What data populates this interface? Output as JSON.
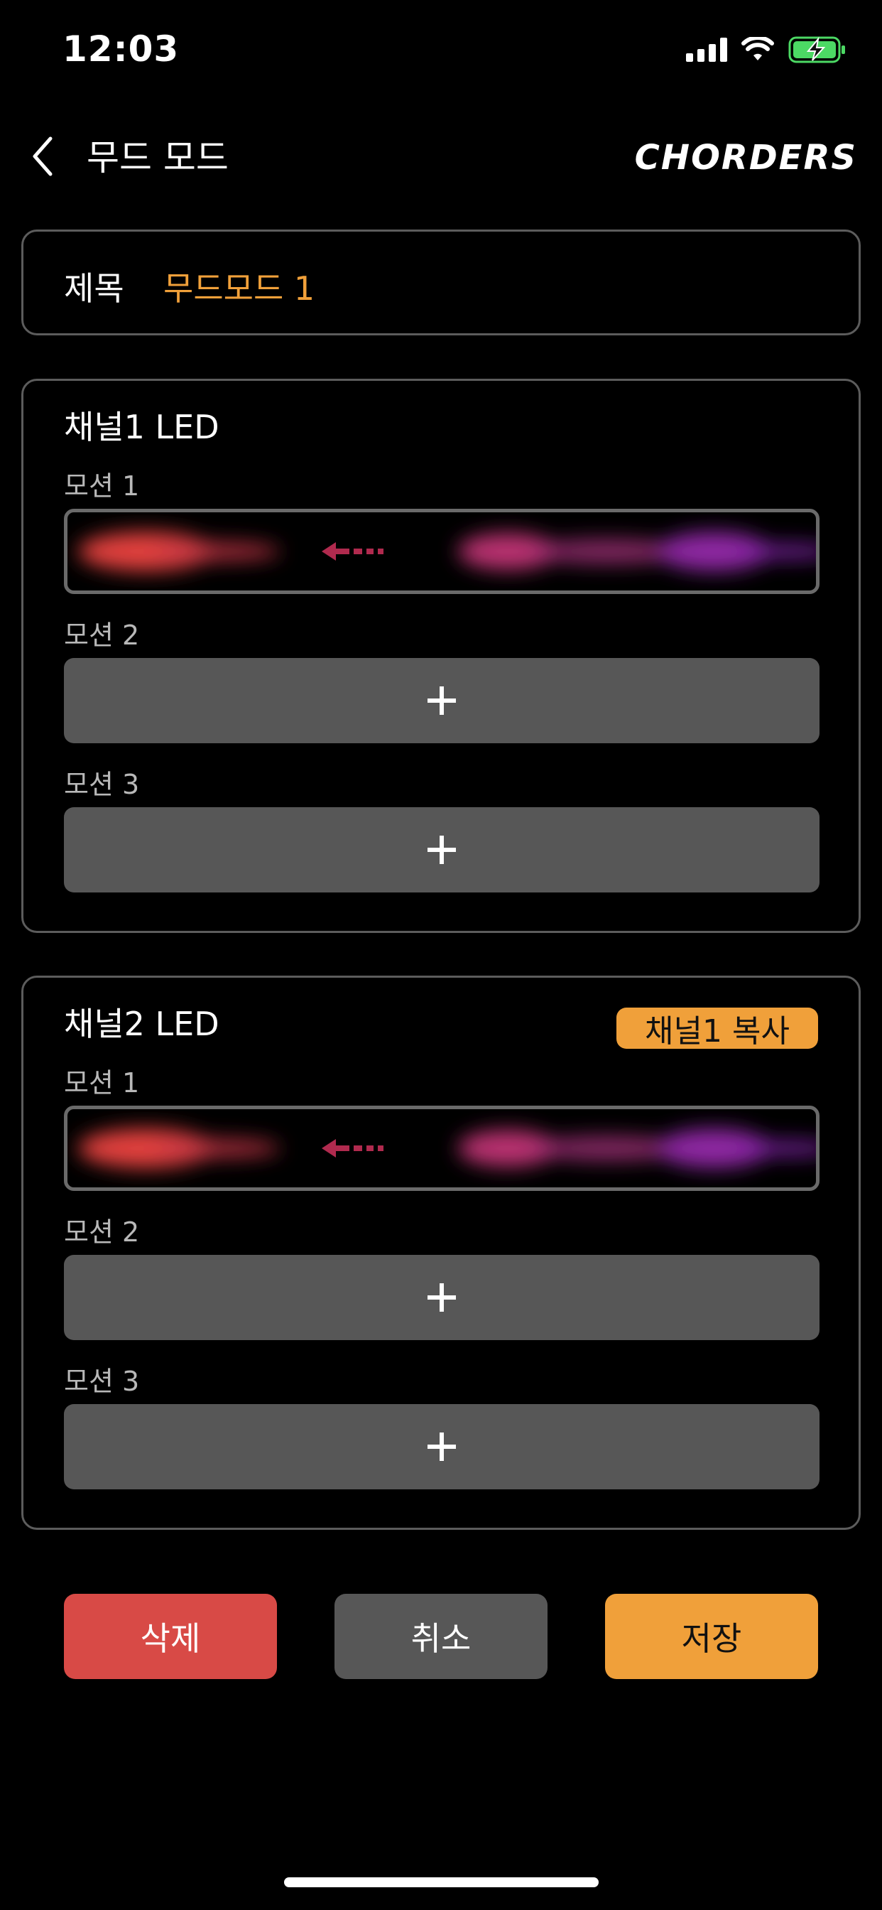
{
  "status_bar": {
    "time": "12:03",
    "icons": [
      "cellular-signal-icon",
      "wifi-icon",
      "battery-charging-icon"
    ],
    "battery_color": "#4cd964"
  },
  "nav": {
    "back_icon": "chevron-left-icon",
    "title": "무드 모드",
    "brand": "CHORDERS"
  },
  "title_field": {
    "label": "제목",
    "value": "무드모드 1"
  },
  "channels": [
    {
      "title": "채널1 LED",
      "motions": [
        {
          "label": "모션 1",
          "state": "pattern",
          "pattern": [
            "red",
            "magenta",
            "purple"
          ],
          "direction": "left"
        },
        {
          "label": "모션 2",
          "state": "empty",
          "add_label": "+"
        },
        {
          "label": "모션 3",
          "state": "empty",
          "add_label": "+"
        }
      ]
    },
    {
      "title": "채널2 LED",
      "copy_button": "채널1 복사",
      "motions": [
        {
          "label": "모션 1",
          "state": "pattern",
          "pattern": [
            "red",
            "magenta",
            "purple"
          ],
          "direction": "left"
        },
        {
          "label": "모션 2",
          "state": "empty",
          "add_label": "+"
        },
        {
          "label": "모션 3",
          "state": "empty",
          "add_label": "+"
        }
      ]
    }
  ],
  "actions": {
    "delete": "삭제",
    "cancel": "취소",
    "save": "저장"
  },
  "colors": {
    "accent": "#f0a03a",
    "danger": "#d84a46",
    "neutral_button": "#575757",
    "border": "#5c5c5c",
    "background": "#000000"
  }
}
